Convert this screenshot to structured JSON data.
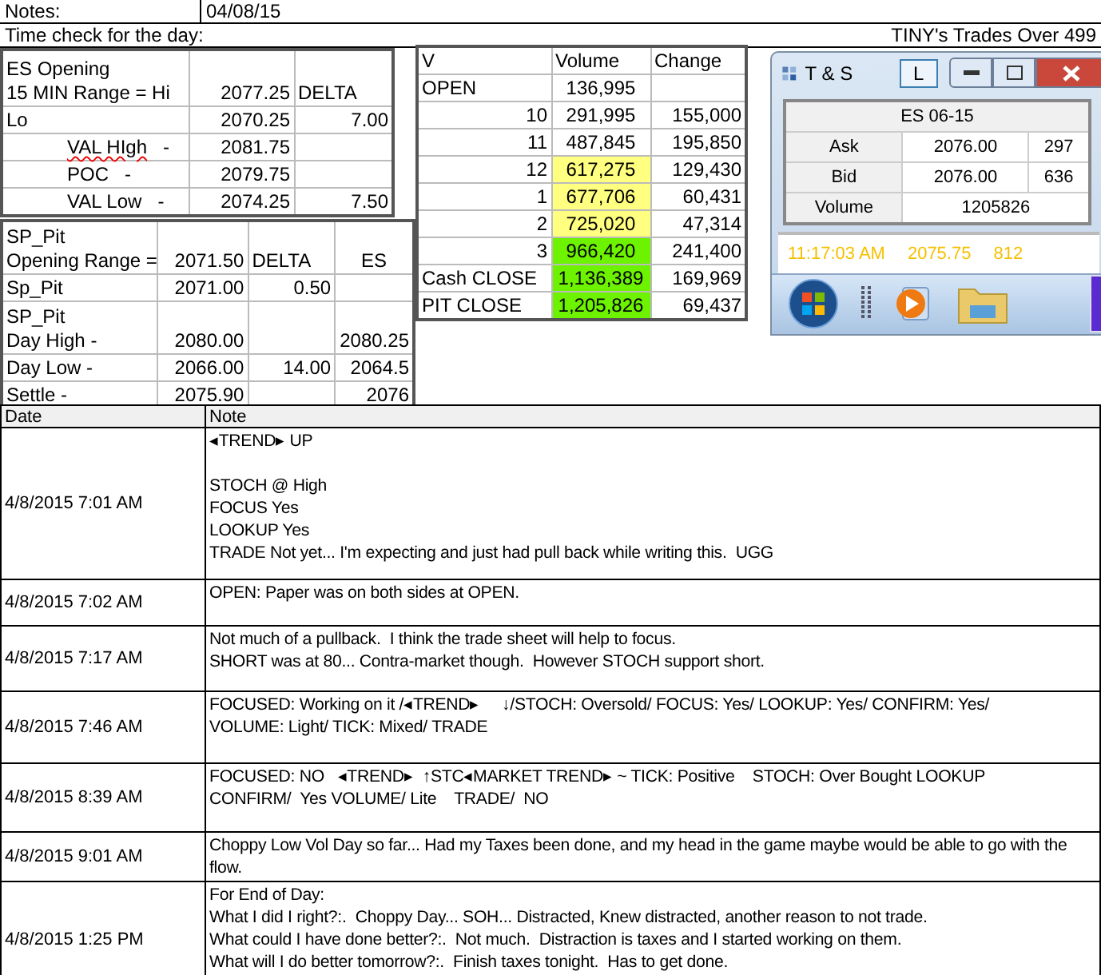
{
  "header": {
    "notes_label": "Notes:",
    "date": "04/08/15",
    "time_check": "Time check for the day:",
    "title": "TINY's Trades Over 499"
  },
  "es_opening": {
    "title_lines": [
      "ES Opening",
      "15 MIN Range = Hi"
    ],
    "range_hi": "2077.25",
    "delta_label": "DELTA",
    "rows": [
      {
        "label": "Lo",
        "value": "2070.25",
        "delta": "7.00",
        "indented": false,
        "misspelled": false
      },
      {
        "label": "VAL HIgh",
        "suffix": "-",
        "value": "2081.75",
        "indented": true,
        "misspelled": true
      },
      {
        "label": "POC",
        "suffix": "-",
        "value": "2079.75",
        "indented": true,
        "misspelled": false
      },
      {
        "label": "VAL Low",
        "suffix": "-",
        "value": "2074.25",
        "delta": "7.50",
        "indented": true,
        "misspelled": false
      }
    ]
  },
  "sp_pit": {
    "title_lines": [
      "SP_Pit",
      "Opening Range ="
    ],
    "opening_range": "2071.50",
    "delta_label": "DELTA",
    "es_label": "ES",
    "rows": [
      {
        "label_lines": [
          "Sp_Pit"
        ],
        "value": "2071.00",
        "delta": "0.50"
      },
      {
        "label_lines": [
          "SP_Pit",
          "Day High -"
        ],
        "value": "2080.00",
        "es": "2080.25"
      },
      {
        "label_lines": [
          "Day Low -"
        ],
        "value": "2066.00",
        "delta": "14.00",
        "es": "2064.5"
      },
      {
        "label_lines": [
          "Settle -"
        ],
        "value": "2075.90",
        "es": "2076"
      }
    ]
  },
  "volume_table": {
    "columns": [
      "V",
      "Volume",
      "Change"
    ],
    "rows": [
      {
        "kind": "session",
        "label": "OPEN",
        "volume": "136,995"
      },
      {
        "kind": "hour",
        "label": "10",
        "volume": "291,995",
        "change": "155,000"
      },
      {
        "kind": "hour",
        "label": "11",
        "volume": "487,845",
        "change": "195,850"
      },
      {
        "kind": "hour",
        "label": "12",
        "volume": "617,275",
        "change": "129,430",
        "color": "#ffff80"
      },
      {
        "kind": "hour",
        "label": "1",
        "volume": "677,706",
        "change": "60,431",
        "color": "#ffff80"
      },
      {
        "kind": "hour",
        "label": "2",
        "volume": "725,020",
        "change": "47,314",
        "color": "#ffff80"
      },
      {
        "kind": "hour",
        "label": "3",
        "volume": "966,420",
        "change": "241,400",
        "color": "#6df200"
      },
      {
        "kind": "session",
        "label": "Cash CLOSE",
        "volume": "1,136,389",
        "change": "169,969",
        "color": "#6df200"
      },
      {
        "kind": "session",
        "label": "PIT CLOSE",
        "volume": "1,205,826",
        "change": "69,437",
        "color": "#6df200"
      }
    ]
  },
  "ts_window": {
    "title": "T & S",
    "button": "L",
    "symbol": "ES 06-15",
    "quotes": [
      {
        "label": "Ask",
        "price": "2076.00",
        "size": "297"
      },
      {
        "label": "Bid",
        "price": "2076.00",
        "size": "636"
      }
    ],
    "volume_label": "Volume",
    "volume": "1205826",
    "last_trade": {
      "time": "11:17:03 AM",
      "price": "2075.75",
      "size": "812"
    }
  },
  "notes_table": {
    "columns": [
      "Date",
      "Note"
    ],
    "rows": [
      {
        "date": "4/8/2015 7:01 AM",
        "paragraphs": [
          [
            "◂TREND▸ UP"
          ],
          [
            "STOCH @ High",
            "FOCUS Yes",
            "LOOKUP Yes",
            "TRADE Not yet... I'm expecting and just had pull back while writing this.  UGG"
          ]
        ]
      },
      {
        "date": "4/8/2015 7:02 AM",
        "paragraphs": [
          [
            "OPEN: Paper was on both sides at OPEN."
          ]
        ]
      },
      {
        "date": "4/8/2015 7:17 AM",
        "paragraphs": [
          [
            "Not much of a pullback.  I think the trade sheet will help to focus.",
            "SHORT was at 80... Contra-market though.  However STOCH support short."
          ]
        ]
      },
      {
        "date": "4/8/2015 7:46 AM",
        "paragraphs": [
          [
            "FOCUSED: Working on it /◂TREND▸     ↓/STOCH: Oversold/ FOCUS: Yes/ LOOKUP: Yes/ CONFIRM: Yes/",
            "VOLUME: Light/ TICK: Mixed/ TRADE"
          ]
        ]
      },
      {
        "date": "4/8/2015 8:39 AM",
        "paragraphs": [
          [
            "FOCUSED: NO   ◂TREND▸  ↑STC◂MARKET TREND▸ ~ TICK: Positive    STOCH: Over Bought LOOKUP",
            "CONFIRM/  Yes VOLUME/ Lite    TRADE/  NO"
          ]
        ]
      },
      {
        "date": "4/8/2015 9:01 AM",
        "paragraphs": [
          [
            "Choppy Low Vol Day so far... Had my Taxes been done, and my head in the game maybe would be able to go with the",
            "flow."
          ]
        ]
      },
      {
        "date": "4/8/2015 1:25 PM",
        "paragraphs": [
          [
            "For End of Day:",
            "What I did I right?:.  Choppy Day... SOH... Distracted, Knew distracted, another reason to not trade.",
            "What could I have done better?:.  Not much.  Distraction is taxes and I started working on them.",
            "What will I do better tomorrow?:.  Finish taxes tonight.  Has to get done."
          ]
        ]
      }
    ]
  }
}
